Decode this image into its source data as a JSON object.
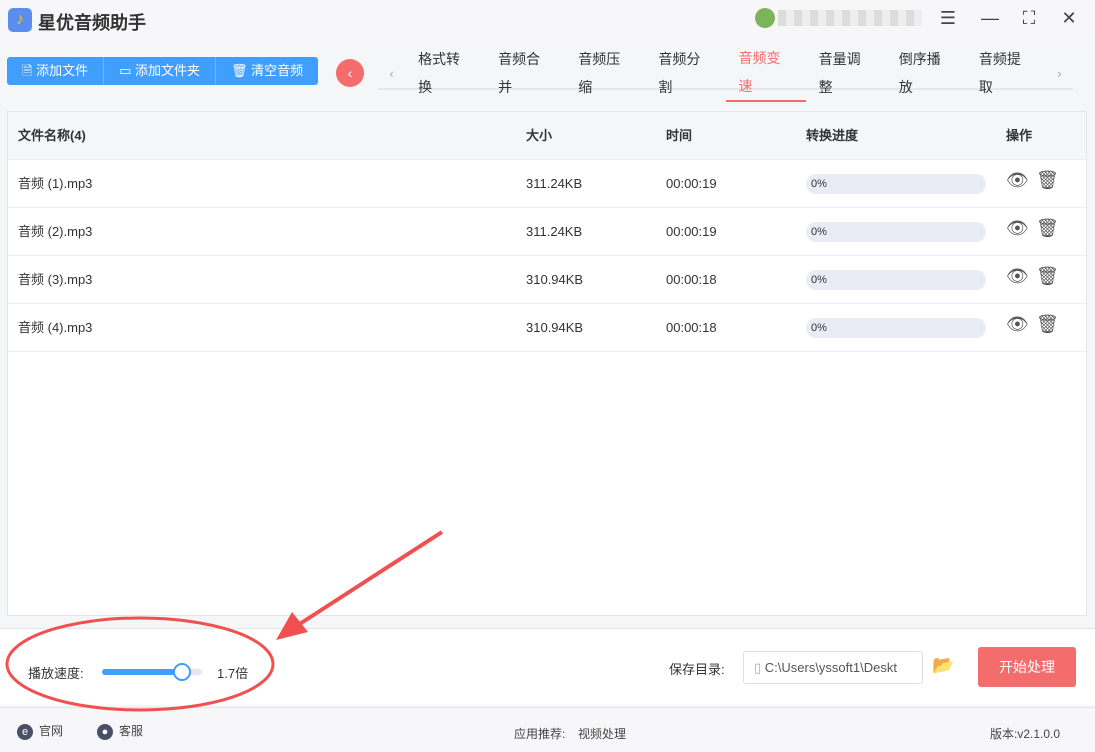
{
  "app": {
    "title": "星优音频助手",
    "logo_icon": "music-note-icon"
  },
  "window": {
    "settings_icon": "sliders-icon",
    "minimize_icon": "minimize-icon",
    "maximize_icon": "fullscreen-icon",
    "close_icon": "close-icon"
  },
  "toolbar": {
    "add_file": "添加文件",
    "add_folder": "添加文件夹",
    "clear": "清空音频"
  },
  "tabs": [
    "格式转换",
    "音频合并",
    "音频压缩",
    "音频分割",
    "音频变速",
    "音量调整",
    "倒序播放",
    "音频提取"
  ],
  "active_tab": "音频变速",
  "table": {
    "headers": {
      "name": "文件名称(4)",
      "size": "大小",
      "time": "时间",
      "progress": "转换进度",
      "ops": "操作"
    },
    "rows": [
      {
        "name": "音频 (1).mp3",
        "size": "311.24KB",
        "time": "00:00:19",
        "progress": "0%"
      },
      {
        "name": "音频 (2).mp3",
        "size": "311.24KB",
        "time": "00:00:19",
        "progress": "0%"
      },
      {
        "name": "音频 (3).mp3",
        "size": "310.94KB",
        "time": "00:00:18",
        "progress": "0%"
      },
      {
        "name": "音频 (4).mp3",
        "size": "310.94KB",
        "time": "00:00:18",
        "progress": "0%"
      }
    ]
  },
  "speed": {
    "label": "播放速度:",
    "value_text": "1.7倍",
    "value": 1.7,
    "fraction": 0.8
  },
  "save": {
    "label": "保存目录:",
    "path": "C:\\Users\\yssoft1\\Deskt",
    "start": "开始处理"
  },
  "footer": {
    "website": "官网",
    "support": "客服",
    "recommend": "应用推荐:",
    "recommend_link": "视频处理",
    "version": "版本:v2.1.0.0"
  },
  "annotation_color": "#f05050"
}
